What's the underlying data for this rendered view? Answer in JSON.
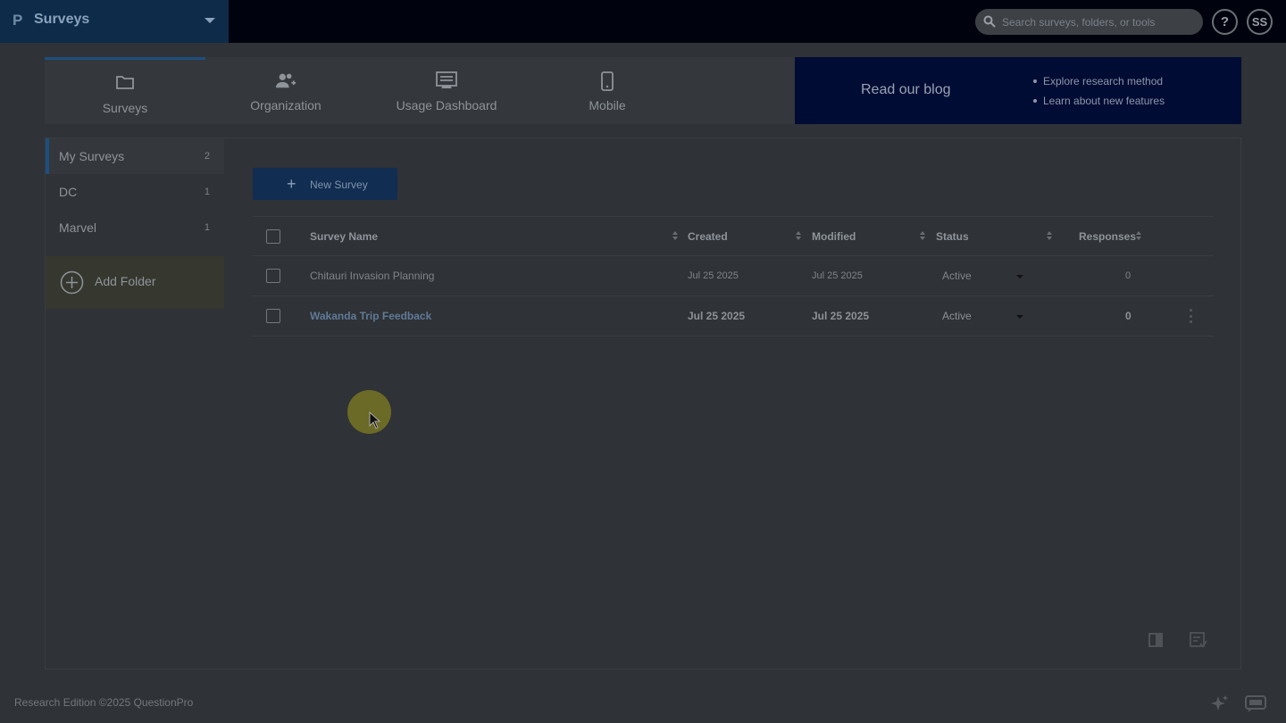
{
  "app": {
    "name": "Surveys",
    "logo": "P"
  },
  "search": {
    "placeholder": "Search surveys, folders, or tools"
  },
  "header": {
    "help_label": "?",
    "avatar_initials": "SS"
  },
  "nav": {
    "tabs": [
      {
        "label": "Surveys",
        "icon": "folder-icon"
      },
      {
        "label": "Organization",
        "icon": "users-icon"
      },
      {
        "label": "Usage Dashboard",
        "icon": "dashboard-icon"
      },
      {
        "label": "Mobile",
        "icon": "mobile-icon"
      }
    ]
  },
  "blog": {
    "title": "Read our blog",
    "links": [
      "Explore research method",
      "Learn about new features"
    ]
  },
  "folders": [
    {
      "name": "My Surveys",
      "count": "2"
    },
    {
      "name": "DC",
      "count": "1"
    },
    {
      "name": "Marvel",
      "count": "1"
    }
  ],
  "add_folder_label": "Add Folder",
  "new_survey_label": "New Survey",
  "table": {
    "headers": {
      "name": "Survey Name",
      "created": "Created",
      "modified": "Modified",
      "status": "Status",
      "responses": "Responses"
    },
    "rows": [
      {
        "name": "Chitauri Invasion Planning",
        "created": "Jul 25 2025",
        "modified": "Jul 25 2025",
        "status": "Active",
        "responses": "0"
      },
      {
        "name": "Wakanda Trip Feedback",
        "created": "Jul 25 2025",
        "modified": "Jul 25 2025",
        "status": "Active",
        "responses": "0"
      }
    ]
  },
  "footer": {
    "text": "Research Edition ©2025 QuestionPro"
  },
  "colors": {
    "accent": "#1d4f7e",
    "topbar": "#00030d",
    "blog_bg": "#000c33"
  }
}
